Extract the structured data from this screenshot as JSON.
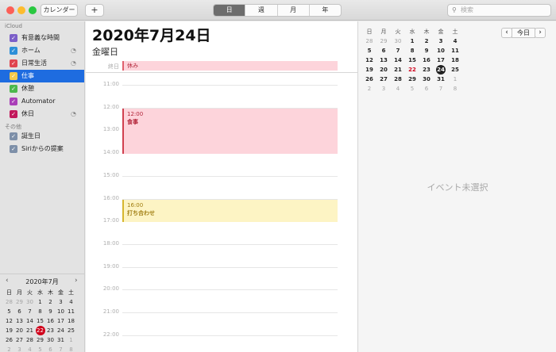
{
  "toolbar": {
    "calendars_label": "カレンダー",
    "add_label": "+",
    "views": [
      "日",
      "週",
      "月",
      "年"
    ],
    "active_view": "日",
    "search_placeholder": "検索"
  },
  "sidebar": {
    "icloud_header": "iCloud",
    "calendars": [
      {
        "label": "有意義な時間",
        "color": "#7b5fc8",
        "shared": false
      },
      {
        "label": "ホーム",
        "color": "#2d8fd8",
        "shared": true
      },
      {
        "label": "日常生活",
        "color": "#e0454f",
        "shared": true
      },
      {
        "label": "仕事",
        "color": "#f2c94c",
        "shared": false,
        "selected": true
      },
      {
        "label": "休憩",
        "color": "#4cb84c",
        "shared": false
      },
      {
        "label": "Automator",
        "color": "#a93fb8",
        "shared": false
      },
      {
        "label": "休日",
        "color": "#c2185b",
        "shared": true
      }
    ],
    "other_header": "その他",
    "other_calendars": [
      {
        "label": "誕生日",
        "color": "#7d8fa8"
      },
      {
        "label": "Siriからの提案",
        "color": "#7d8fa8"
      }
    ]
  },
  "mini_calendar": {
    "title": "2020年7月",
    "weekdays": [
      "日",
      "月",
      "火",
      "水",
      "木",
      "金",
      "土"
    ],
    "days": [
      "28",
      "29",
      "30",
      "1",
      "2",
      "3",
      "4",
      "5",
      "6",
      "7",
      "8",
      "9",
      "10",
      "11",
      "12",
      "13",
      "14",
      "15",
      "16",
      "17",
      "18",
      "19",
      "20",
      "21",
      "22",
      "23",
      "24",
      "25",
      "26",
      "27",
      "28",
      "29",
      "30",
      "31",
      "1",
      "2",
      "3",
      "4",
      "5",
      "6",
      "7",
      "8"
    ],
    "today": "22"
  },
  "day_view": {
    "date_title": "2020年7月24日",
    "weekday": "金曜日",
    "allday_label": "終日",
    "allday_event": "休み",
    "hours": [
      "11:00",
      "12:00",
      "13:00",
      "14:00",
      "15:00",
      "16:00",
      "17:00",
      "18:00",
      "19:00",
      "20:00",
      "21:00",
      "22:00"
    ],
    "events": [
      {
        "time": "12:00",
        "title": "食事"
      },
      {
        "time": "16:00",
        "title": "打ち合わせ"
      }
    ]
  },
  "right_panel": {
    "today_label": "今日",
    "weekdays": [
      "日",
      "月",
      "火",
      "水",
      "木",
      "金",
      "土"
    ],
    "days": [
      "28",
      "29",
      "30",
      "1",
      "2",
      "3",
      "4",
      "5",
      "6",
      "7",
      "8",
      "9",
      "10",
      "11",
      "12",
      "13",
      "14",
      "15",
      "16",
      "17",
      "18",
      "19",
      "20",
      "21",
      "22",
      "23",
      "24",
      "25",
      "26",
      "27",
      "28",
      "29",
      "30",
      "31",
      "1",
      "2",
      "3",
      "4",
      "5",
      "6",
      "7",
      "8"
    ],
    "selected_day": "24",
    "red_day": "22",
    "no_event_text": "イベント未選択"
  }
}
